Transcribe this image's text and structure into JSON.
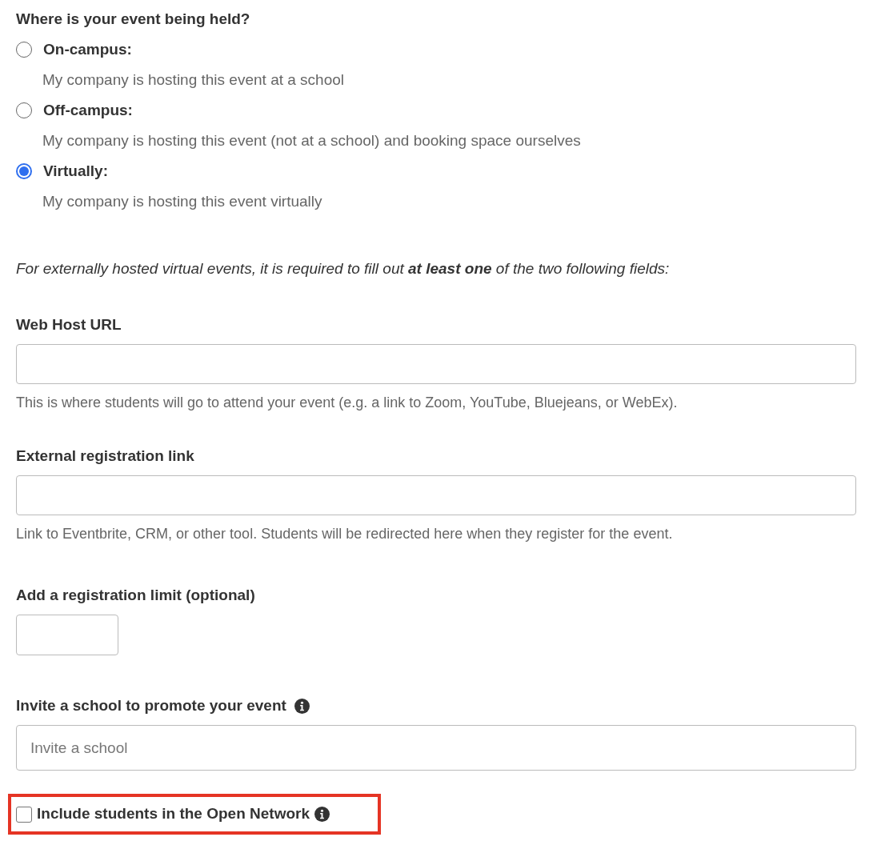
{
  "question": "Where is your event being held?",
  "options": [
    {
      "label": "On-campus:",
      "description": "My company is hosting this event at a school",
      "selected": false
    },
    {
      "label": "Off-campus:",
      "description": "My company is hosting this event (not at a school) and booking space ourselves",
      "selected": false
    },
    {
      "label": "Virtually:",
      "description": "My company is hosting this event virtually",
      "selected": true
    }
  ],
  "note": "For externally hosted virtual events, it is required to fill out **at least one** of the two following fields:",
  "fields": [
    {
      "label": "Web Host URL",
      "help": "This is where students will go to attend your event (e.g. a link to Zoom, YouTube, Bluejeans, or WebEx)."
    },
    {
      "label": "External registration link",
      "help": "Link to Eventbrite, CRM, or other tool. Students will be redirected here when they register for the event."
    }
  ],
  "limit": {
    "label": "Add a registration limit (optional)"
  },
  "invite": {
    "label": "Invite a school to promote your event",
    "placeholder": "Invite a school"
  },
  "open_network": {
    "label": "Include students in the Open Network",
    "checked": false,
    "highlighted": true
  }
}
